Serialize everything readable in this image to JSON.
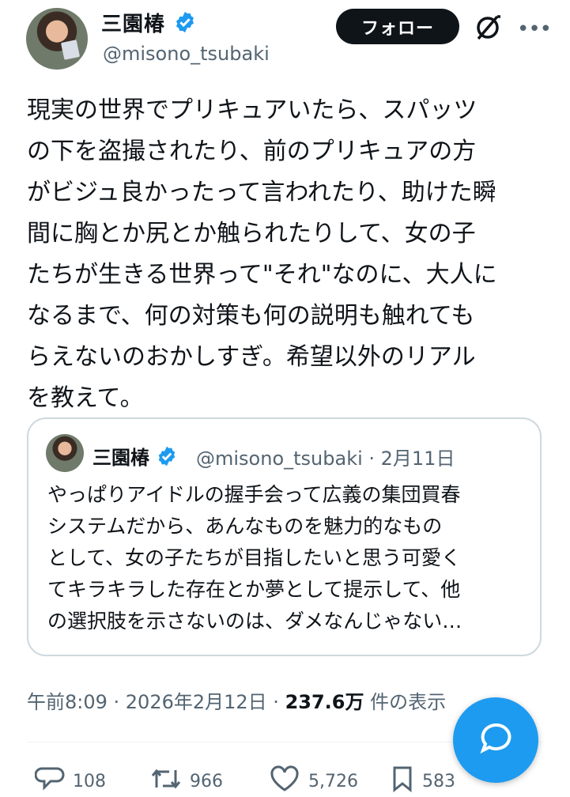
{
  "author": {
    "name": "三園椿",
    "handle": "@misono_tsubaki",
    "verified": true
  },
  "header": {
    "follow_label": "フォロー",
    "grok_icon": "grok-icon",
    "more_label": "•••"
  },
  "tweet": {
    "text": "現実の世界でプリキュアいたら、スパッツ\nの下を盗撮されたり、前のプリキュアの方\nがビジュ良かったって言われたり、助けた瞬\n間に胸とか尻とか触られたりして、女の子\nたちが生きる世界って\"それ\"なのに、大人に\nなるまで、何の対策も何の説明も触れても\nらえないのおかしすぎ。希望以外のリアル\nを教えて。"
  },
  "quote": {
    "name": "三園椿",
    "handle_date": "@misono_tsubaki · 2月11日",
    "text": "やっぱりアイドルの握手会って広義の集団買春\nシステムだから、あんなものを魅力的なもの\nとして、女の子たちが目指したいと思う可愛く\nてキラキラした存在とか夢として提示して、他\nの選択肢を示さないのは、ダメなんじゃない…"
  },
  "meta": {
    "time_date": "午前8:09 · 2026年2月12日 · ",
    "views": "237.6万",
    "views_label": " 件の表示"
  },
  "actions": {
    "replies": "108",
    "retweets": "966",
    "likes": "5,726",
    "bookmarks": "583"
  },
  "colors": {
    "accent": "#1d9bf0",
    "text": "#0f1419",
    "secondary": "#536471",
    "border": "#cfd9de"
  }
}
